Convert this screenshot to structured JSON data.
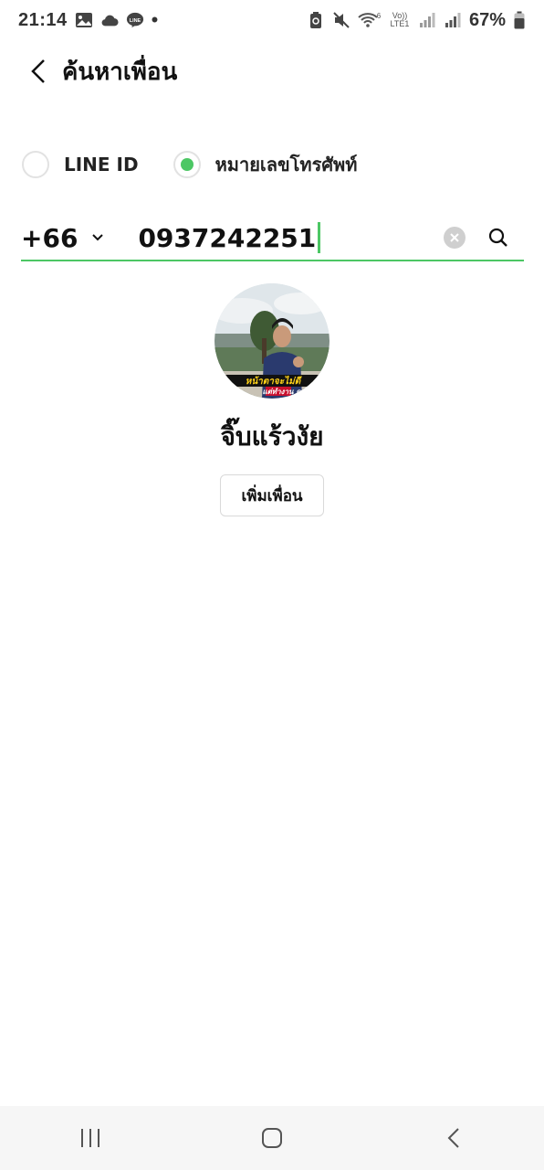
{
  "status_bar": {
    "time": "21:14",
    "battery": "67%",
    "left_icons": [
      "gallery-icon",
      "cloud-icon",
      "line-app-icon",
      "notification-dot"
    ],
    "line_badge": "LINE",
    "network_labels": {
      "volte": "Vo))",
      "lte": "LTE1",
      "wifi_band": "6"
    },
    "right_icons": [
      "battery-saver-icon",
      "mute-icon",
      "wifi-icon",
      "signal-icon",
      "signal-icon",
      "battery-icon"
    ]
  },
  "header": {
    "title": "ค้นหาเพื่อน",
    "back_icon": "chevron-left-icon"
  },
  "search_type": {
    "options": [
      {
        "label": "LINE ID",
        "selected": false
      },
      {
        "label": "หมายเลขโทรศัพท์",
        "selected": true
      }
    ]
  },
  "phone_search": {
    "country_code": "+66",
    "value": "0937242251",
    "clear_icon": "clear-icon",
    "search_icon": "search-icon"
  },
  "result": {
    "name": "จิ๊บแร้วงัย",
    "avatar_caption_1": "หน้าตาจะไม่ดี",
    "avatar_caption_2": "แต่ทำงาน ควา",
    "add_button_label": "เพิ่มเพื่อน"
  },
  "colors": {
    "accent": "#4cc764",
    "nav_background": "#f6f6f6",
    "text": "#111111"
  },
  "nav_bar": {
    "buttons": [
      "recent-apps-icon",
      "home-icon",
      "back-icon"
    ]
  }
}
